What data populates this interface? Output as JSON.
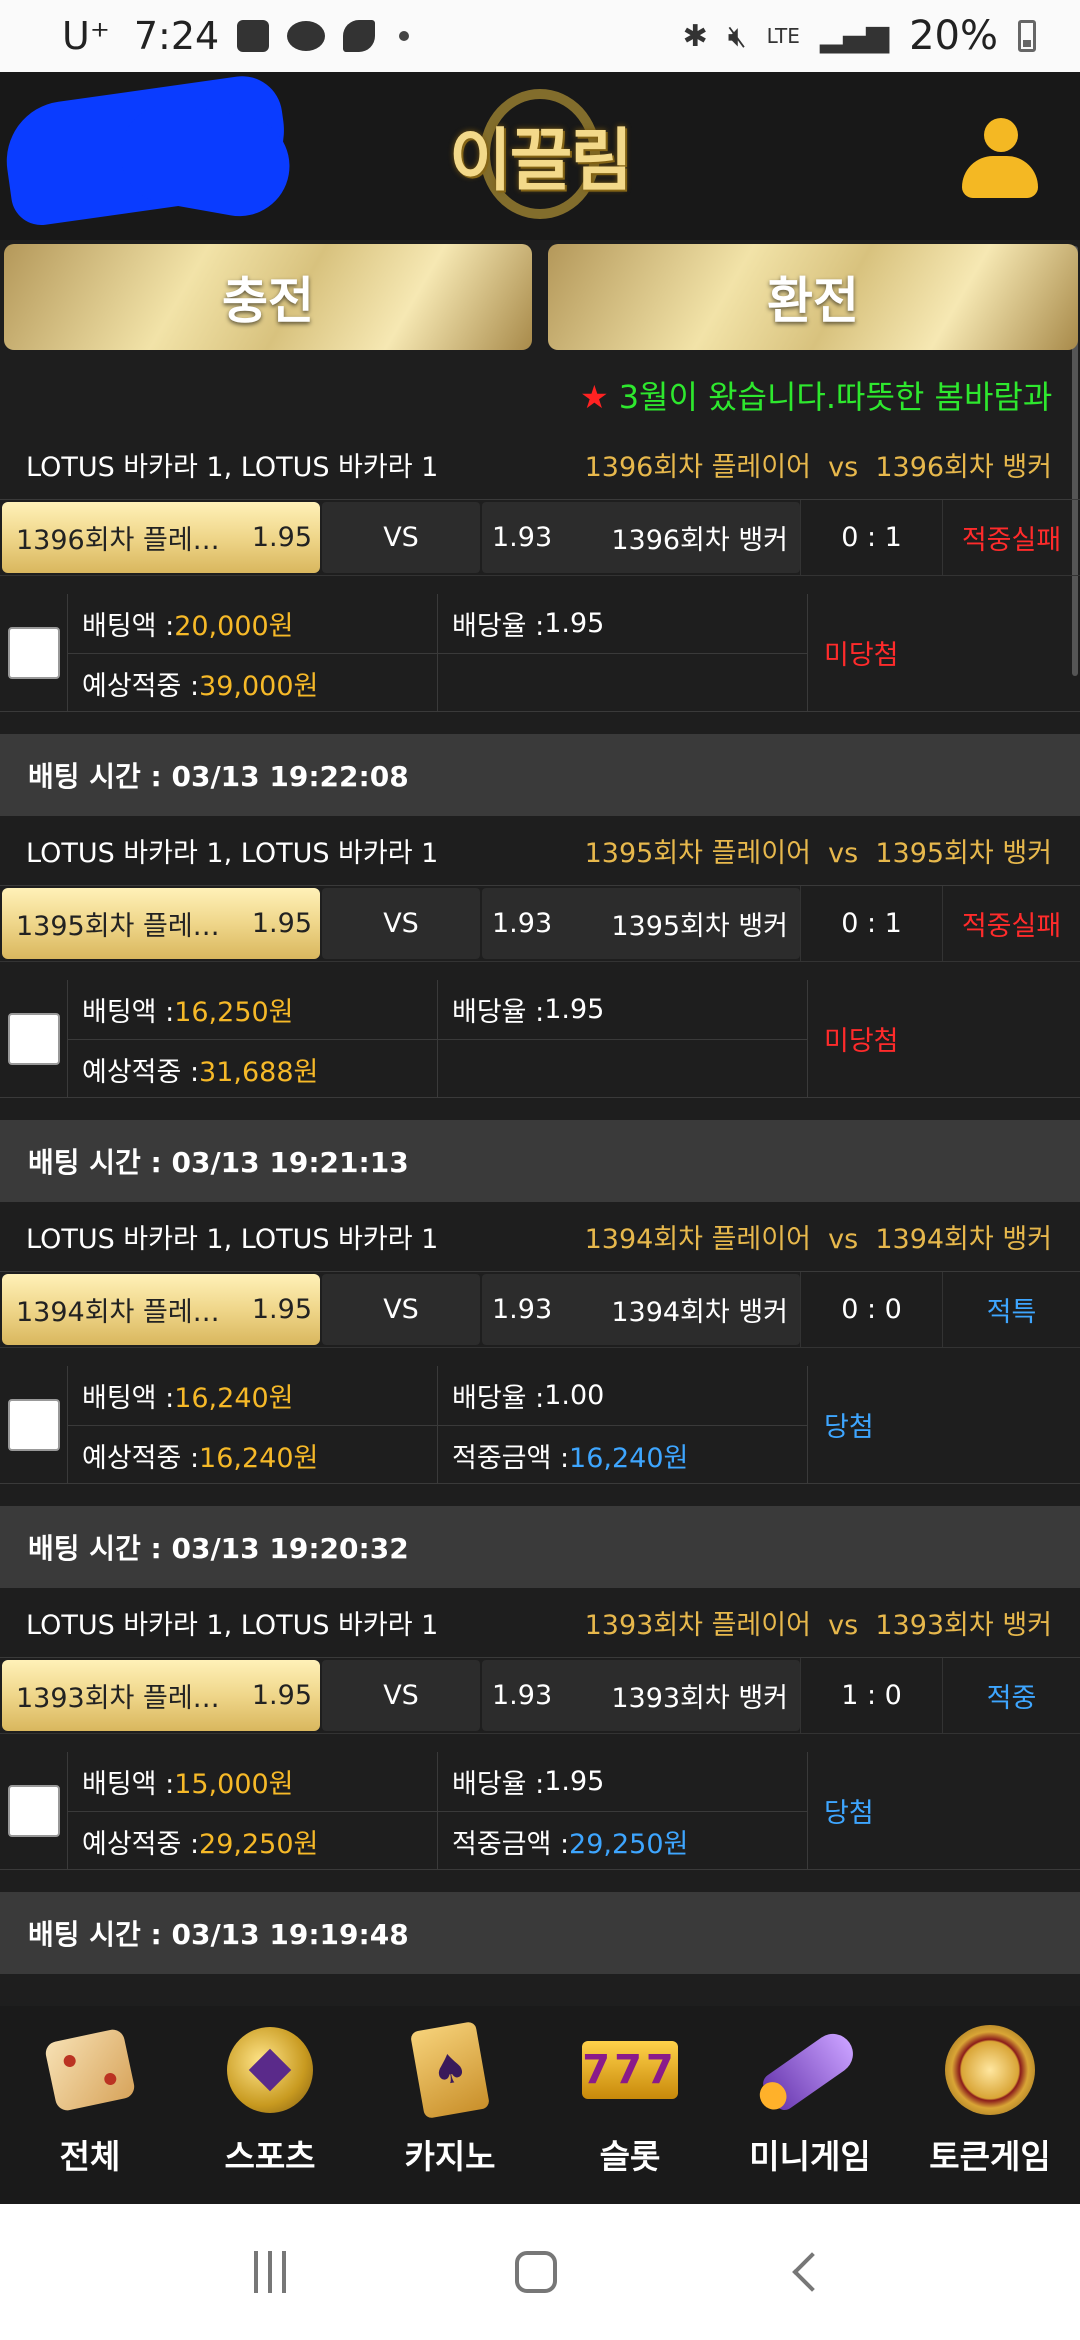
{
  "status_bar": {
    "carrier": "U⁺",
    "time": "7:24",
    "network": "LTE",
    "battery": "20%"
  },
  "header": {
    "logo_text": "이끌림"
  },
  "actions": {
    "charge_label": "충전",
    "exchange_label": "환전"
  },
  "notice": {
    "text": "3월이 왔습니다.따뜻한 봄바람과 "
  },
  "bets": [
    {
      "game": "LOTUS 바카라 1, LOTUS 바카라 1",
      "match_home": "1396회차 플레이어",
      "vs_word": "vs",
      "match_away": "1396회차 뱅커",
      "home_short": "1396회차 플레…",
      "home_odds": "1.95",
      "vs_label": "VS",
      "away_odds": "1.93",
      "away_name": "1396회차 뱅커",
      "score": "0 : 1",
      "result": "적중실패",
      "bet_label": "배팅액 : ",
      "bet_amount": "20,000원",
      "rate_label": "배당율 : ",
      "rate": "1.95",
      "expected_label": "예상적중 : ",
      "expected": "39,000원",
      "win_label": "",
      "win_amount": "",
      "status": "미당첨"
    },
    {
      "time_label": "배팅 시간 : 03/13 19:22:08",
      "game": "LOTUS 바카라 1, LOTUS 바카라 1",
      "match_home": "1395회차 플레이어",
      "vs_word": "vs",
      "match_away": "1395회차 뱅커",
      "home_short": "1395회차 플레…",
      "home_odds": "1.95",
      "vs_label": "VS",
      "away_odds": "1.93",
      "away_name": "1395회차 뱅커",
      "score": "0 : 1",
      "result": "적중실패",
      "bet_label": "배팅액 : ",
      "bet_amount": "16,250원",
      "rate_label": "배당율 : ",
      "rate": "1.95",
      "expected_label": "예상적중 : ",
      "expected": "31,688원",
      "win_label": "",
      "win_amount": "",
      "status": "미당첨"
    },
    {
      "time_label": "배팅 시간 : 03/13 19:21:13",
      "game": "LOTUS 바카라 1, LOTUS 바카라 1",
      "match_home": "1394회차 플레이어",
      "vs_word": "vs",
      "match_away": "1394회차 뱅커",
      "home_short": "1394회차 플레…",
      "home_odds": "1.95",
      "vs_label": "VS",
      "away_odds": "1.93",
      "away_name": "1394회차 뱅커",
      "score": "0 : 0",
      "result": "적특",
      "bet_label": "배팅액 : ",
      "bet_amount": "16,240원",
      "rate_label": "배당율 : ",
      "rate": "1.00",
      "expected_label": "예상적중 : ",
      "expected": "16,240원",
      "win_label": "적중금액 : ",
      "win_amount": "16,240원",
      "status": "당첨"
    },
    {
      "time_label": "배팅 시간 : 03/13 19:20:32",
      "game": "LOTUS 바카라 1, LOTUS 바카라 1",
      "match_home": "1393회차 플레이어",
      "vs_word": "vs",
      "match_away": "1393회차 뱅커",
      "home_short": "1393회차 플레…",
      "home_odds": "1.95",
      "vs_label": "VS",
      "away_odds": "1.93",
      "away_name": "1393회차 뱅커",
      "score": "1 : 0",
      "result": "적중",
      "bet_label": "배팅액 : ",
      "bet_amount": "15,000원",
      "rate_label": "배당율 : ",
      "rate": "1.95",
      "expected_label": "예상적중 : ",
      "expected": "29,250원",
      "win_label": "적중금액 : ",
      "win_amount": "29,250원",
      "status": "당첨"
    }
  ],
  "last_time_label": "배팅 시간 : 03/13 19:19:48",
  "nav": [
    {
      "label": "전체",
      "icon": "dice-icon"
    },
    {
      "label": "스포츠",
      "icon": "soccer-ball-icon"
    },
    {
      "label": "카지노",
      "icon": "cards-icon"
    },
    {
      "label": "슬롯",
      "icon": "slot-777-icon"
    },
    {
      "label": "미니게임",
      "icon": "rocket-icon"
    },
    {
      "label": "토큰게임",
      "icon": "roulette-icon"
    }
  ],
  "colors": {
    "result_fail": "#ff2b2b",
    "result_win": "#3ea6ff",
    "amount_gold": "#f6b928",
    "notice_green": "#2ee82e"
  }
}
